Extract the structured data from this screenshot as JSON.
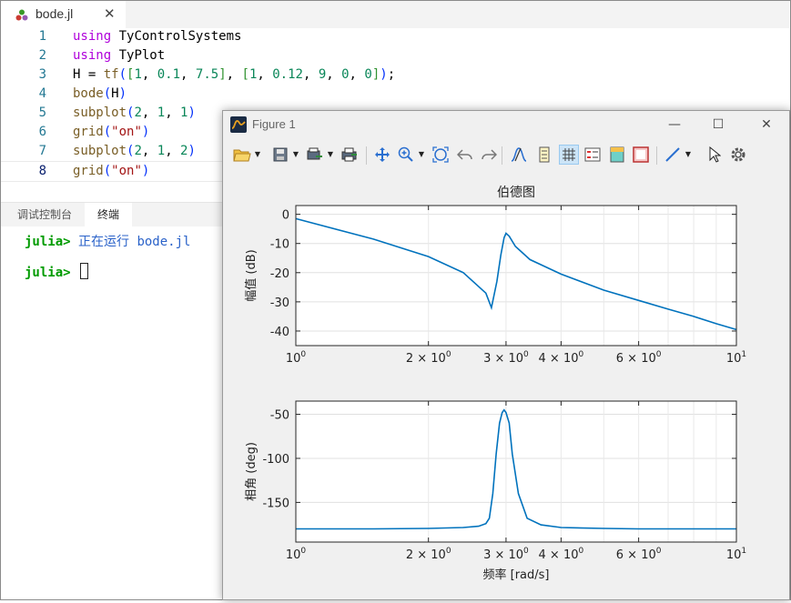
{
  "editor": {
    "tab": {
      "label": "bode.jl",
      "close": "✕"
    },
    "lines": [
      {
        "no": "1",
        "tokens": [
          [
            "kw",
            "using"
          ],
          [
            "",
            " TyControlSystems"
          ]
        ]
      },
      {
        "no": "2",
        "tokens": [
          [
            "kw",
            "using"
          ],
          [
            "",
            " TyPlot"
          ]
        ]
      },
      {
        "no": "3",
        "tokens": [
          [
            "",
            "H = "
          ],
          [
            "fn",
            "tf"
          ],
          [
            "br1",
            "("
          ],
          [
            "br2",
            "["
          ],
          [
            "num",
            "1"
          ],
          [
            "",
            ", "
          ],
          [
            "num",
            "0.1"
          ],
          [
            "",
            ", "
          ],
          [
            "num",
            "7.5"
          ],
          [
            "br2",
            "]"
          ],
          [
            "",
            ", "
          ],
          [
            "br2",
            "["
          ],
          [
            "num",
            "1"
          ],
          [
            "",
            ", "
          ],
          [
            "num",
            "0.12"
          ],
          [
            "",
            ", "
          ],
          [
            "num",
            "9"
          ],
          [
            "",
            ", "
          ],
          [
            "num",
            "0"
          ],
          [
            "",
            ", "
          ],
          [
            "num",
            "0"
          ],
          [
            "br2",
            "]"
          ],
          [
            "br1",
            ")"
          ],
          [
            "",
            ";"
          ]
        ]
      },
      {
        "no": "4",
        "tokens": [
          [
            "fn",
            "bode"
          ],
          [
            "br1",
            "("
          ],
          [
            "",
            "H"
          ],
          [
            "br1",
            ")"
          ]
        ]
      },
      {
        "no": "5",
        "tokens": [
          [
            "fn",
            "subplot"
          ],
          [
            "br1",
            "("
          ],
          [
            "num",
            "2"
          ],
          [
            "",
            ", "
          ],
          [
            "num",
            "1"
          ],
          [
            "",
            ", "
          ],
          [
            "num",
            "1"
          ],
          [
            "br1",
            ")"
          ]
        ]
      },
      {
        "no": "6",
        "tokens": [
          [
            "fn",
            "grid"
          ],
          [
            "br1",
            "("
          ],
          [
            "str",
            "\"on\""
          ],
          [
            "br1",
            ")"
          ]
        ]
      },
      {
        "no": "7",
        "tokens": [
          [
            "fn",
            "subplot"
          ],
          [
            "br1",
            "("
          ],
          [
            "num",
            "2"
          ],
          [
            "",
            ", "
          ],
          [
            "num",
            "1"
          ],
          [
            "",
            ", "
          ],
          [
            "num",
            "2"
          ],
          [
            "br1",
            ")"
          ]
        ]
      },
      {
        "no": "8",
        "tokens": [
          [
            "fn",
            "grid"
          ],
          [
            "br1",
            "("
          ],
          [
            "str",
            "\"on\""
          ],
          [
            "br1",
            ")"
          ]
        ]
      }
    ]
  },
  "panel": {
    "tabs": [
      "调试控制台",
      "终端"
    ],
    "active_tab": 1,
    "prompt": "julia>",
    "running_message": "正在运行 bode.jl"
  },
  "figure": {
    "title": "Figure 1",
    "buttons": {
      "minimize": "—",
      "maximize": "☐",
      "close": "✕"
    },
    "toolbar_icons": [
      "open-file-icon",
      "save-icon",
      "export-icon",
      "print-icon",
      "pan-icon",
      "zoom-in-icon",
      "zoom-fit-icon",
      "undo-icon",
      "redo-icon",
      "data-tip-icon",
      "colorbar-icon",
      "grid-icon",
      "legend-icon",
      "fill-color-icon",
      "border-icon",
      "line-icon",
      "pointer-icon",
      "settings-icon"
    ],
    "accent": "#0072bd"
  },
  "chart_data": [
    {
      "type": "line",
      "title": "伯德图",
      "xlabel": "",
      "ylabel": "幅值 (dB)",
      "xscale": "log",
      "xlim": [
        1,
        10
      ],
      "ylim": [
        -45,
        3
      ],
      "yticks": [
        0,
        -10,
        -20,
        -30,
        -40
      ],
      "xticklabels": [
        "10^0",
        "2 × 10^0",
        "3 × 10^0",
        "4 × 10^0",
        "6 × 10^0",
        "10^1"
      ],
      "grid": true,
      "x": [
        1,
        1.5,
        2,
        2.4,
        2.7,
        2.78,
        2.86,
        2.92,
        2.97,
        3.0,
        3.05,
        3.15,
        3.4,
        4,
        5,
        6,
        7,
        8,
        9,
        10
      ],
      "y": [
        -1.5,
        -8.5,
        -14.5,
        -20,
        -27,
        -32,
        -23,
        -14,
        -8,
        -6.5,
        -7.5,
        -11,
        -15.5,
        -20.5,
        -26,
        -29.5,
        -32.5,
        -35,
        -37.5,
        -39.5
      ]
    },
    {
      "type": "line",
      "title": "",
      "xlabel": "频率 [rad/s]",
      "ylabel": "相角 (deg)",
      "xscale": "log",
      "xlim": [
        1,
        10
      ],
      "ylim": [
        -195,
        -35
      ],
      "yticks": [
        -50,
        -100,
        -150
      ],
      "xticklabels": [
        "10^0",
        "2 × 10^0",
        "3 × 10^0",
        "4 × 10^0",
        "6 × 10^0",
        "10^1"
      ],
      "grid": true,
      "x": [
        1,
        1.5,
        2,
        2.4,
        2.6,
        2.7,
        2.75,
        2.8,
        2.85,
        2.9,
        2.94,
        2.97,
        3.0,
        3.05,
        3.1,
        3.2,
        3.35,
        3.6,
        4,
        5,
        6,
        8,
        10
      ],
      "y": [
        -180,
        -180,
        -179.5,
        -178.5,
        -177,
        -174,
        -168,
        -140,
        -95,
        -60,
        -48,
        -45,
        -48,
        -60,
        -95,
        -140,
        -168,
        -175.5,
        -178.5,
        -179.5,
        -180,
        -180,
        -180
      ]
    }
  ]
}
